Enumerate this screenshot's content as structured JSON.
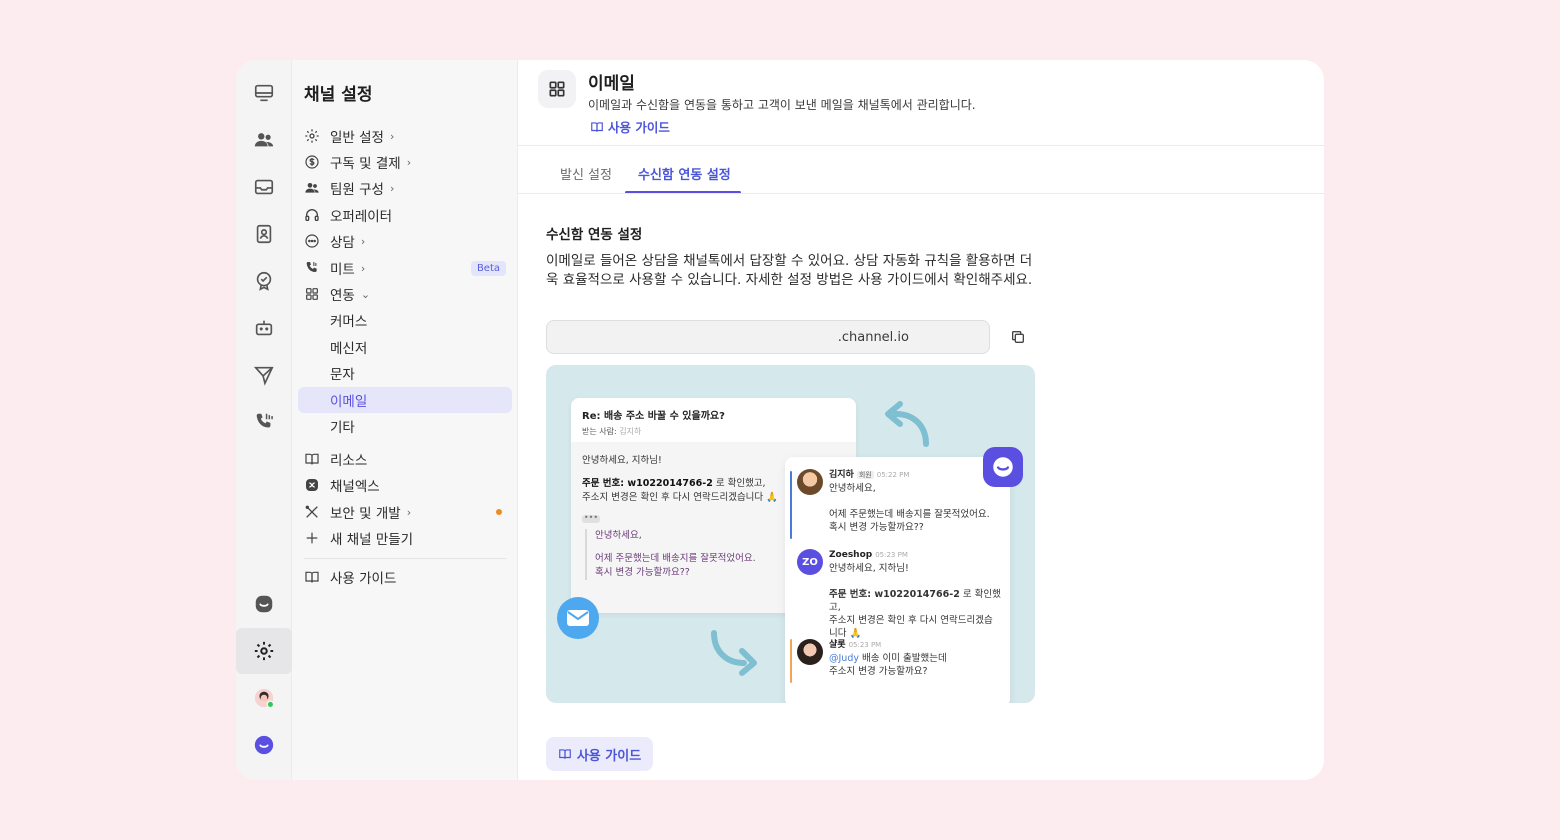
{
  "sidebar": {
    "title": "채널 설정",
    "items": [
      {
        "label": "일반 설정",
        "chevron": "›",
        "icon": "gear-icon"
      },
      {
        "label": "구독 및 결제",
        "chevron": "›",
        "icon": "dollar-icon"
      },
      {
        "label": "팀원 구성",
        "chevron": "›",
        "icon": "people-icon"
      },
      {
        "label": "오퍼레이터",
        "chevron": "",
        "icon": "headset-icon"
      },
      {
        "label": "상담",
        "chevron": "›",
        "icon": "chat-bubble-icon"
      },
      {
        "label": "미트",
        "chevron": "›",
        "icon": "phone-icon",
        "badge": "Beta"
      },
      {
        "label": "연동",
        "chevron": "⌄",
        "icon": "grid-icon"
      }
    ],
    "sub_items": [
      "커머스",
      "메신저",
      "문자",
      "이메일",
      "기타"
    ],
    "lower_items": [
      {
        "label": "리소스",
        "chevron": "",
        "icon": "book-icon"
      },
      {
        "label": "채널엑스",
        "chevron": "",
        "icon": "channelx-icon"
      },
      {
        "label": "보안 및 개발",
        "chevron": "›",
        "icon": "tools-icon"
      },
      {
        "label": "새 채널 만들기",
        "chevron": "",
        "icon": "plus-icon"
      }
    ],
    "footer_item": {
      "label": "사용 가이드",
      "icon": "book-icon"
    }
  },
  "header": {
    "title": "이메일",
    "description": "이메일과 수신함을 연동을 통하고 고객이 보낸 메일을 채널톡에서 관리합니다.",
    "guide_link": "사용 가이드"
  },
  "tabs": [
    {
      "label": "발신 설정",
      "active": false
    },
    {
      "label": "수신함 연동 설정",
      "active": true
    }
  ],
  "section": {
    "title": "수신함 연동 설정",
    "description": "이메일로 들어온 상담을 채널톡에서 답장할 수 있어요. 상담 자동화 규칙을 활용하면 더욱 효율적으로 사용할 수 있습니다. 자세한 설정 방법은 사용 가이드에서 확인해주세요.",
    "email_domain": ".channel.io"
  },
  "illustration": {
    "mail": {
      "subject": "Re: 배송 주소 바꿀 수 있을까요?",
      "to_label": "받는 사람:",
      "to_name": "김지하",
      "greeting": "안녕하세요, 지하님!",
      "order_prefix": "주문 번호: w1022014766-2",
      "order_suffix": " 로 확인했고,",
      "order_line2": "주소지 변경은 확인 후 다시 연락드리겠습니다 🙏",
      "dots": "•••",
      "quote_line1": "안녕하세요,",
      "quote_line2": "어제 주문했는데 배송지를 잘못적었어요.",
      "quote_line3": "혹시 변경 가능할까요??"
    },
    "chat": [
      {
        "name": "김지하",
        "tag": "회원",
        "time": "05:22 PM",
        "line1": "안녕하세요,",
        "line2": "어제 주문했는데 배송지를 잘못적었어요.",
        "line3": "혹시 변경 가능할까요??"
      },
      {
        "name": "Zoeshop",
        "time": "05:23 PM",
        "line1": "안녕하세요, 지하님!",
        "order_prefix": "주문 번호: w1022014766-2",
        "order_suffix": " 로 확인했고,",
        "line3": "주소지 변경은 확인 후 다시 연락드리겠습",
        "line4": "니다 🙏",
        "avatar": "ZO"
      },
      {
        "name": "샬롯",
        "time": "05:23 PM",
        "mention": "@Judy",
        "line1": " 배송 이미 출발했는데",
        "line2": "주소지 변경 가능할까요?"
      }
    ]
  },
  "guide_button": "사용 가이드",
  "colors": {
    "accent": "#5a4fe0",
    "link": "#4b55d9",
    "background": "#fdecef"
  }
}
